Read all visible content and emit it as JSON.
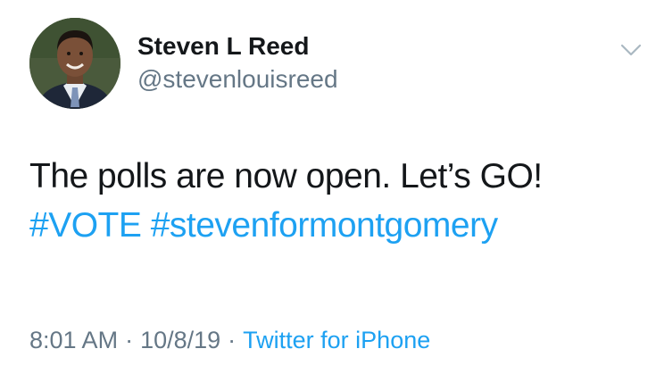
{
  "user": {
    "display_name": "Steven L Reed",
    "handle": "@stevenlouisreed"
  },
  "tweet": {
    "text": "The polls are now open. Let’s GO!",
    "hashtags": [
      "#VOTE",
      "#stevenformontgomery"
    ]
  },
  "meta": {
    "time": "8:01 AM",
    "date": "10/8/19",
    "separator": "·",
    "source": "Twitter for iPhone"
  },
  "icons": {
    "menu": "chevron-down-icon",
    "avatar": "profile-photo"
  },
  "colors": {
    "text": "#14171a",
    "secondary": "#657786",
    "link": "#1da1f2"
  }
}
